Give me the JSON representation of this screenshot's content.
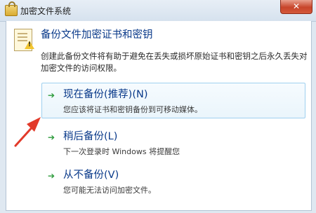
{
  "window": {
    "title": "加密文件系统",
    "close_label": "✕"
  },
  "header": {
    "title": "备份文件加密证书和密钥",
    "description": "创建此备份文件将有助于避免在丢失或损坏原始证书和密钥之后永久丢失对加密文件的访问权限。"
  },
  "options": [
    {
      "title": "现在备份(推荐)(N)",
      "subtitle": "您应该将证书和密钥备份到可移动媒体。"
    },
    {
      "title": "稍后备份(L)",
      "subtitle": "下一次登录时 Windows 将提醒您"
    },
    {
      "title": "从不备份(V)",
      "subtitle": "您可能无法访问加密文件。"
    }
  ],
  "icons": {
    "window": "lock-folder-icon",
    "header": "certificate-warning-icon",
    "option_arrow": "green-arrow-icon",
    "annotation": "red-pointer-arrow"
  },
  "colors": {
    "link_blue": "#0a3a8a",
    "arrow_green": "#2b9b3a",
    "annotation_red": "#e23a2a",
    "close_red": "#c7452b"
  }
}
